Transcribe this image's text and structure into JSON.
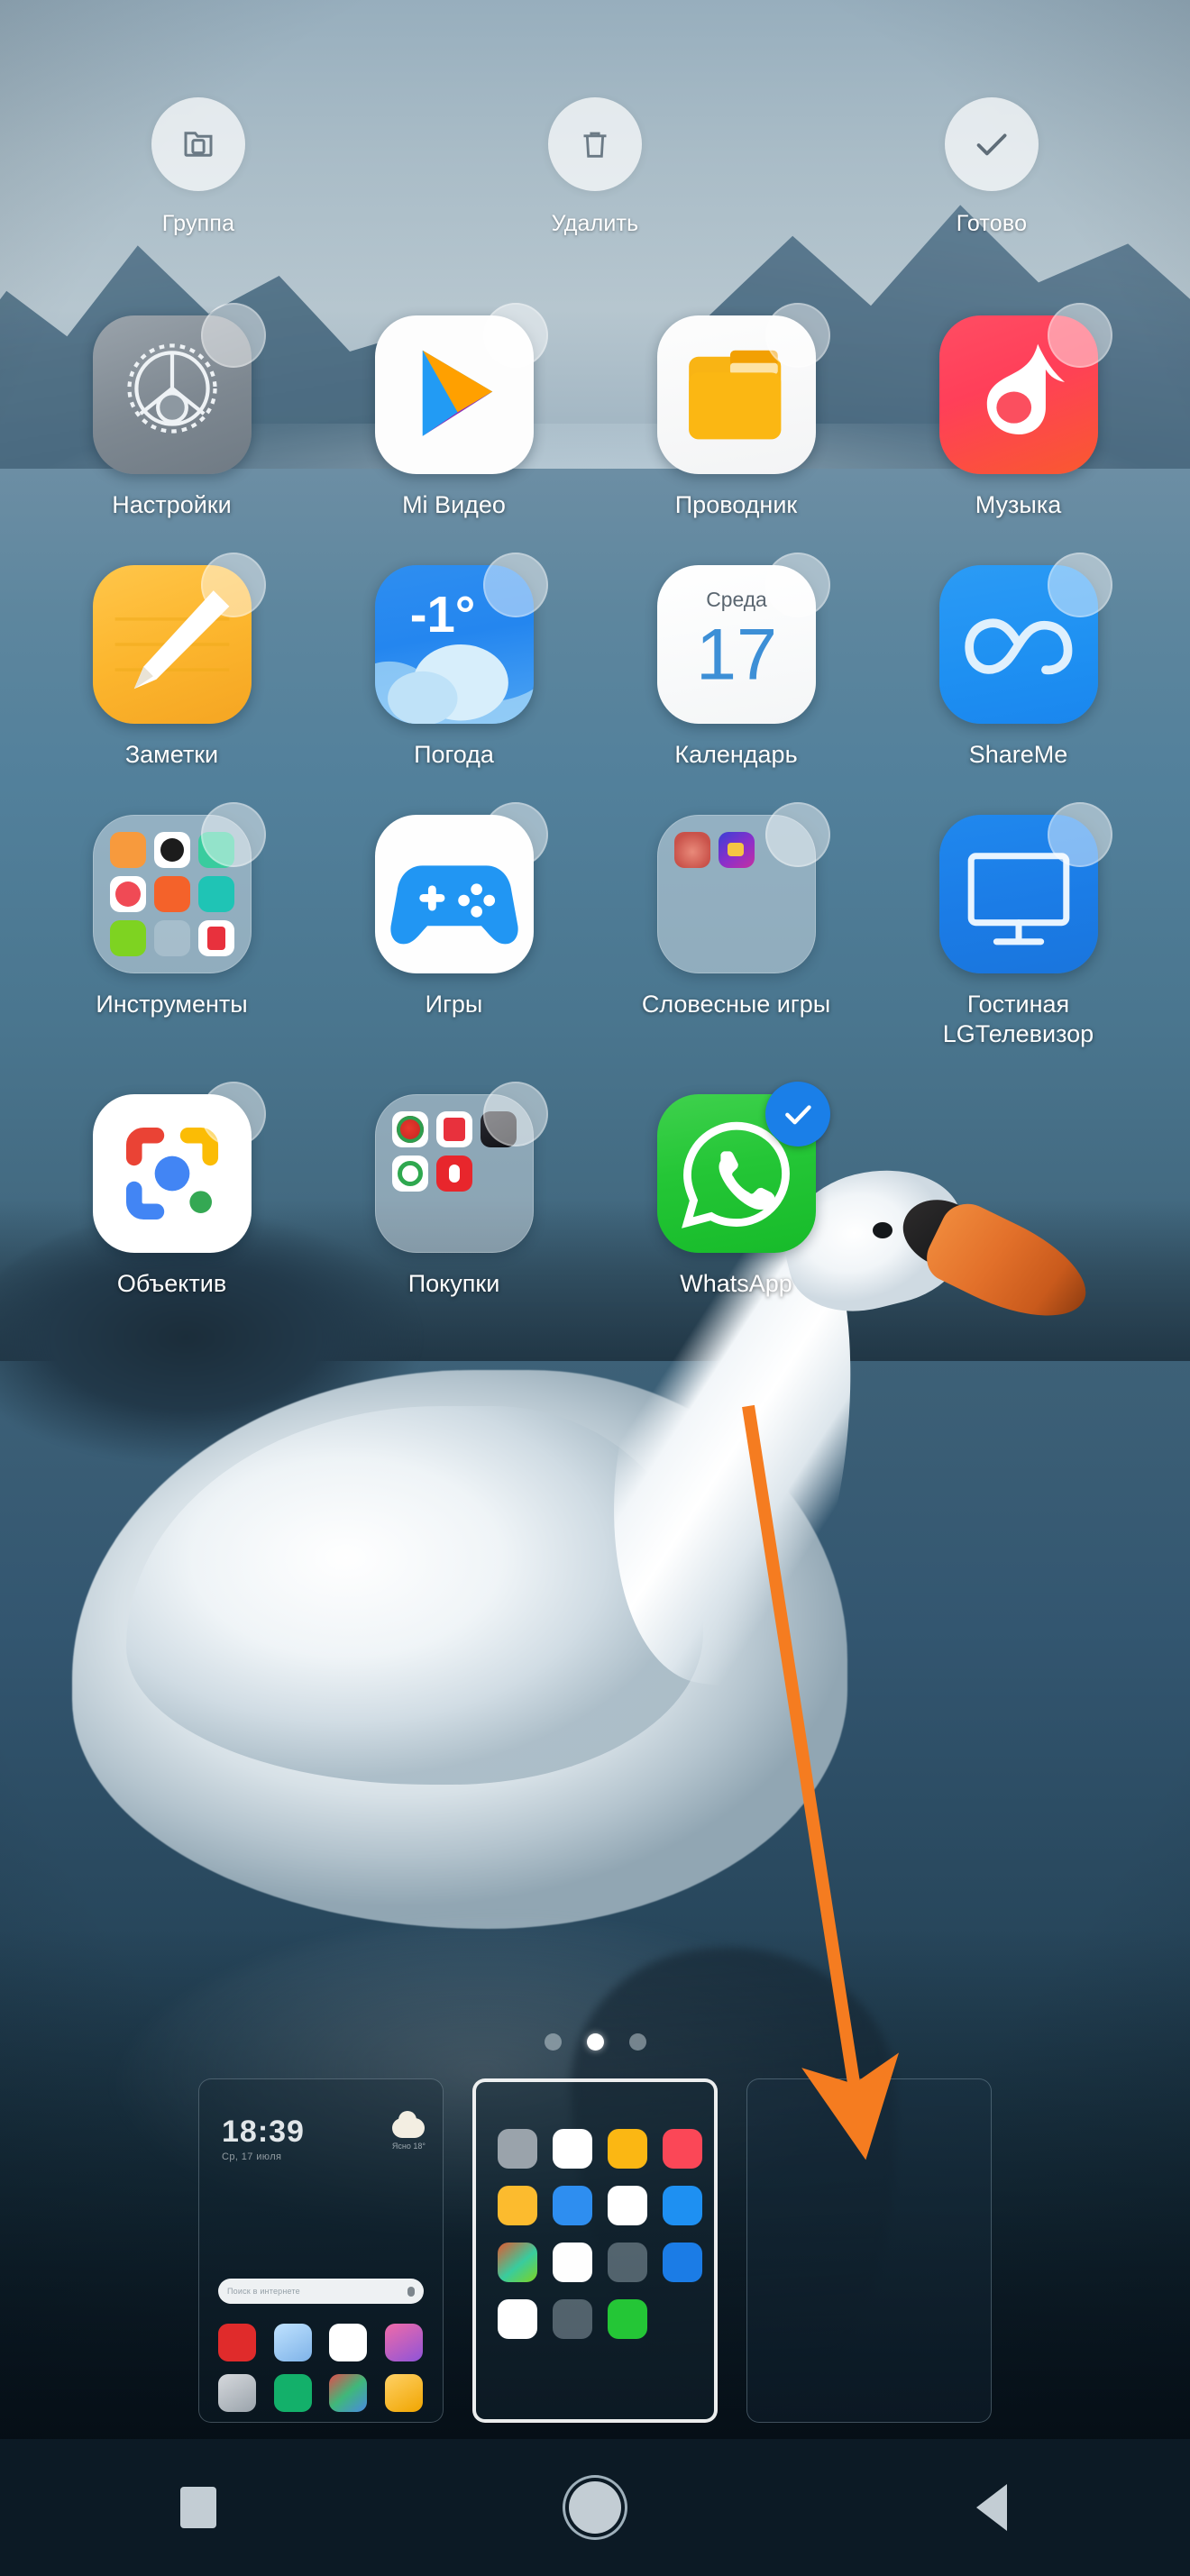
{
  "topbar": {
    "actions": [
      {
        "label": "Группа",
        "icon": "folder-group-icon"
      },
      {
        "label": "Удалить",
        "icon": "trash-icon"
      },
      {
        "label": "Готово",
        "icon": "check-icon"
      }
    ]
  },
  "home": {
    "apps": [
      {
        "label": "Настройки",
        "icon": "settings-gear-icon",
        "selected": false
      },
      {
        "label": "Mi Видео",
        "icon": "mi-video-icon",
        "selected": false
      },
      {
        "label": "Проводник",
        "icon": "file-manager-icon",
        "selected": false
      },
      {
        "label": "Музыка",
        "icon": "music-note-icon",
        "selected": false
      },
      {
        "label": "Заметки",
        "icon": "notes-pen-icon",
        "selected": false
      },
      {
        "label": "Погода",
        "icon": "weather-icon",
        "selected": false,
        "temperature": "-1°"
      },
      {
        "label": "Календарь",
        "icon": "calendar-icon",
        "selected": false,
        "weekday": "Среда",
        "day": "17"
      },
      {
        "label": "ShareMe",
        "icon": "shareme-infinity-icon",
        "selected": false
      },
      {
        "label": "Инструменты",
        "icon": "folder-tools-icon",
        "selected": false,
        "is_folder": true
      },
      {
        "label": "Игры",
        "icon": "gamepad-icon",
        "selected": false
      },
      {
        "label": "Словесные игры",
        "icon": "folder-word-games-icon",
        "selected": false,
        "is_folder": true
      },
      {
        "label": "Гостиная LGТелевизор",
        "icon": "tv-icon",
        "selected": false
      },
      {
        "label": "Объектив",
        "icon": "google-lens-icon",
        "selected": false
      },
      {
        "label": "Покупки",
        "icon": "folder-shopping-icon",
        "selected": false,
        "is_folder": true
      },
      {
        "label": "WhatsApp",
        "icon": "whatsapp-icon",
        "selected": true
      }
    ]
  },
  "pager": {
    "total_pages": 3,
    "active_page": 2,
    "thumbnails": [
      {
        "name": "page-1",
        "selected": false,
        "empty": false,
        "clock_time": "18:39",
        "clock_sub": "Ср, 17 июля",
        "weather_label": "Ясно  18°"
      },
      {
        "name": "page-2",
        "selected": true,
        "empty": false
      },
      {
        "name": "page-3",
        "selected": false,
        "empty": true
      }
    ],
    "search_placeholder": "Поиск в интернете"
  },
  "navbar": {
    "buttons": [
      {
        "label": "Недавние",
        "icon": "recents-square-icon"
      },
      {
        "label": "Главная",
        "icon": "home-circle-icon"
      },
      {
        "label": "Назад",
        "icon": "back-triangle-icon"
      }
    ]
  },
  "annotation": {
    "arrow_color": "#f57c20",
    "arrow_name": "drag-target-arrow"
  }
}
